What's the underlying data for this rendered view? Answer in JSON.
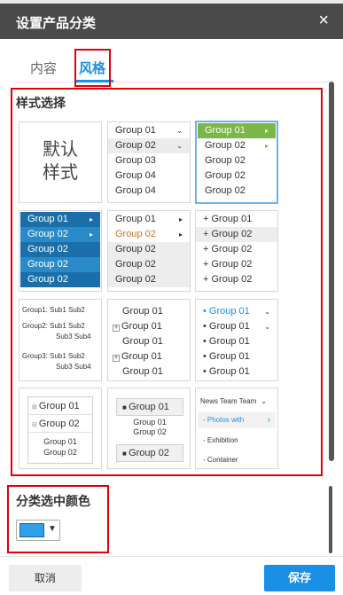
{
  "header": {
    "title": "设置产品分类",
    "close": "×"
  },
  "tabs": {
    "content": "内容",
    "style": "风格"
  },
  "style_section": {
    "title": "样式选择"
  },
  "color_section": {
    "title": "分类选中颜色",
    "swatch_color": "#2ea1e8",
    "arrow": "▼"
  },
  "footer": {
    "cancel": "取消",
    "save": "保存"
  },
  "colors": {
    "accent": "#1a8fe6",
    "header_bg": "#4a4a4a",
    "green": "#7ab648",
    "dark_blue": "#1b6fa8",
    "orange": "#c8742c",
    "highlight": "#ff0000"
  },
  "cards": {
    "default": {
      "line1": "默认",
      "line2": "样式"
    },
    "c2": [
      "Group 01",
      "Group 02",
      "Group 03",
      "Group 04",
      "Group 04"
    ],
    "c3": [
      "Group 01",
      "Group 02",
      "Group 02",
      "Group 02",
      "Group 02"
    ],
    "c4": [
      "Group 01",
      "Group 02",
      "Group 02",
      "Group 02",
      "Group 02"
    ],
    "c5": [
      "Group 01",
      "Group 02",
      "Group 02",
      "Group 02",
      "Group 02"
    ],
    "c6": [
      "+ Group 01",
      "+ Group 02",
      "+ Group 02",
      "+ Group 02",
      "+ Group 02"
    ],
    "c7": {
      "g1": "Group1:",
      "g1a": "Sub1",
      "g1b": "Sub2",
      "g2": "Group2:",
      "g2a": "Sub1",
      "g2b": "Sub2",
      "g2c": "Sub3",
      "g2d": "Sub4",
      "g3": "Group3:",
      "g3a": "Sub1",
      "g3b": "Sub2",
      "g3c": "Sub3",
      "g3d": "Sub4"
    },
    "c8": [
      "Group 01",
      "Group 01",
      "Group 01",
      "Group 01",
      "Group 01"
    ],
    "c9": [
      "Group 01",
      "Group 01",
      "Group 01",
      "Group 01",
      "Group 01"
    ],
    "c10": {
      "a": "Group 01",
      "b": "Group 02",
      "c": "Group 01",
      "d": "Group 02"
    },
    "c11": {
      "a": "Group 01",
      "b": "Group 01",
      "c": "Group 02",
      "d": "Group 02"
    },
    "c12": {
      "a": "News Team Team",
      "b": "- Photos with",
      "c": "- Exhibition",
      "d": "- Container"
    }
  }
}
